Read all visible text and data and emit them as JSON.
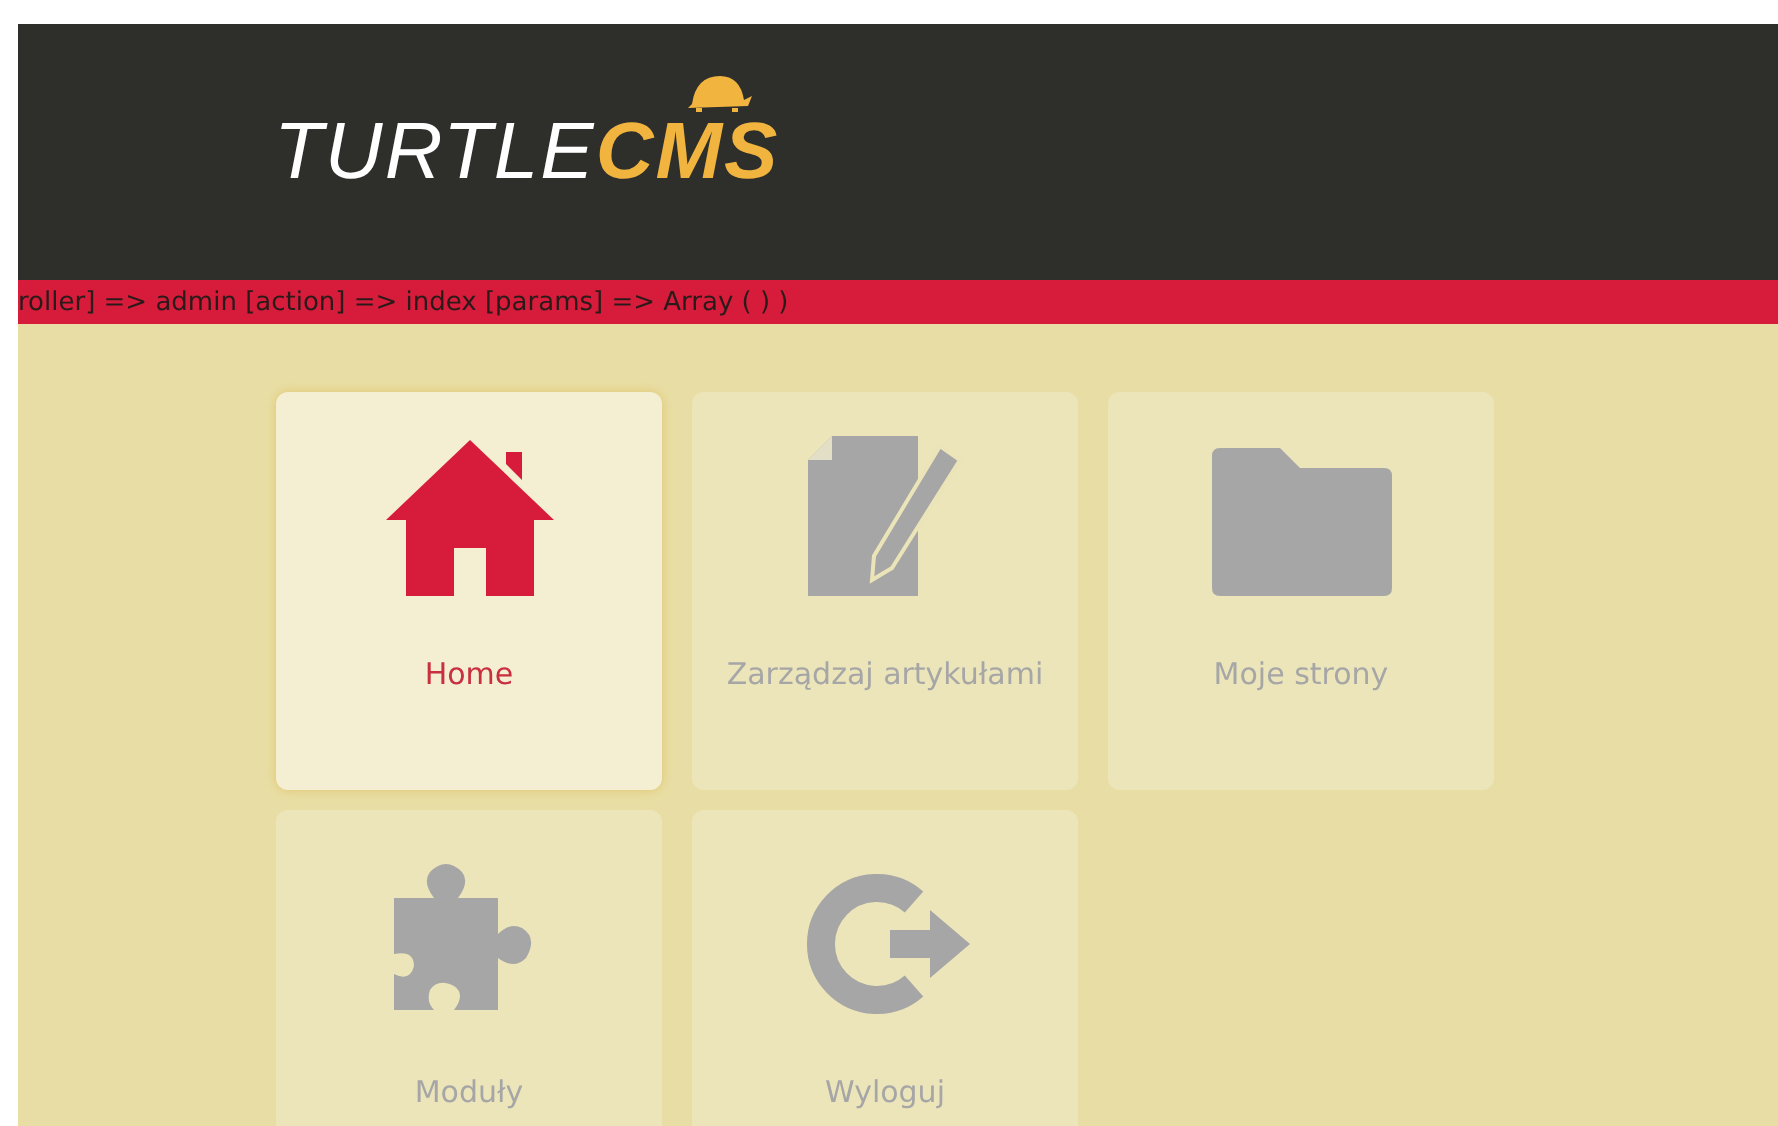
{
  "logo": {
    "part1": "TURTLE",
    "part2": "CMS"
  },
  "debug_bar": "roller] => admin [action] => index [params] => Array ( ) )",
  "tiles": [
    {
      "label": "Home",
      "kind": "home",
      "selected": true
    },
    {
      "label": "Zarządzaj artykułami",
      "kind": "article",
      "selected": false
    },
    {
      "label": "Moje strony",
      "kind": "folder",
      "selected": false
    },
    {
      "label": "Moduły",
      "kind": "puzzle",
      "selected": false
    },
    {
      "label": "Wyloguj",
      "kind": "logout",
      "selected": false
    }
  ]
}
